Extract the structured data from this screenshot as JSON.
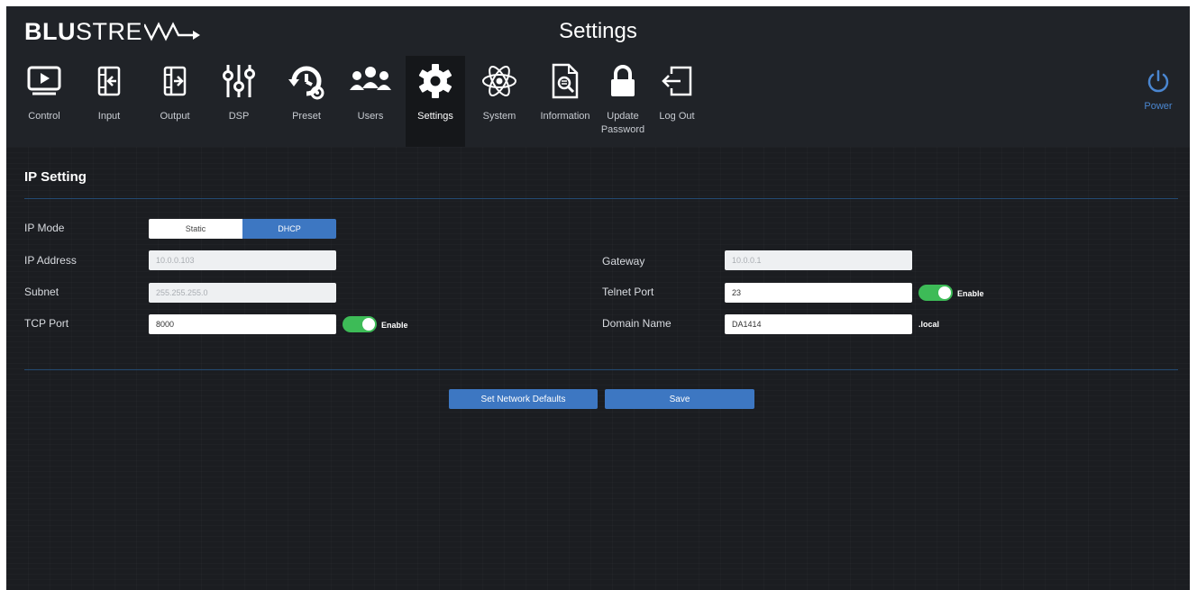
{
  "header": {
    "logo_part1": "BLU",
    "logo_part2": "STRE",
    "title": "Settings"
  },
  "nav": {
    "items": [
      {
        "label": "Control",
        "icon": "play-screen-icon"
      },
      {
        "label": "Input",
        "icon": "input-icon"
      },
      {
        "label": "Output",
        "icon": "output-icon"
      },
      {
        "label": "DSP",
        "icon": "sliders-icon"
      },
      {
        "label": "Preset",
        "icon": "history-gear-icon"
      },
      {
        "label": "Users",
        "icon": "users-icon"
      },
      {
        "label": "Settings",
        "icon": "gear-icon",
        "active": true
      },
      {
        "label": "System",
        "icon": "atom-icon"
      },
      {
        "label": "Information",
        "icon": "document-search-icon"
      },
      {
        "label": "Update Password",
        "icon": "lock-icon"
      },
      {
        "label": "Log Out",
        "icon": "logout-icon"
      }
    ],
    "power_label": "Power"
  },
  "ip_setting": {
    "title": "IP Setting",
    "ip_mode_label": "IP Mode",
    "mode_options": [
      "Static",
      "DHCP"
    ],
    "selected_mode": "DHCP",
    "ip_address_label": "IP Address",
    "ip_address_value": "10.0.0.103",
    "subnet_label": "Subnet",
    "subnet_value": "255.255.255.0",
    "tcp_port_label": "TCP Port",
    "tcp_port_value": "8000",
    "tcp_enable_label": "Enable",
    "gateway_label": "Gateway",
    "gateway_value": "10.0.0.1",
    "telnet_port_label": "Telnet Port",
    "telnet_port_value": "23",
    "telnet_enable_label": "Enable",
    "domain_name_label": "Domain Name",
    "domain_name_value": "DA1414",
    "domain_suffix": ".local"
  },
  "buttons": {
    "set_network_defaults": "Set Network Defaults",
    "save": "Save"
  },
  "colors": {
    "accent": "#3d77c2",
    "toggle_on": "#3dbb57",
    "background": "#1b1d21"
  }
}
